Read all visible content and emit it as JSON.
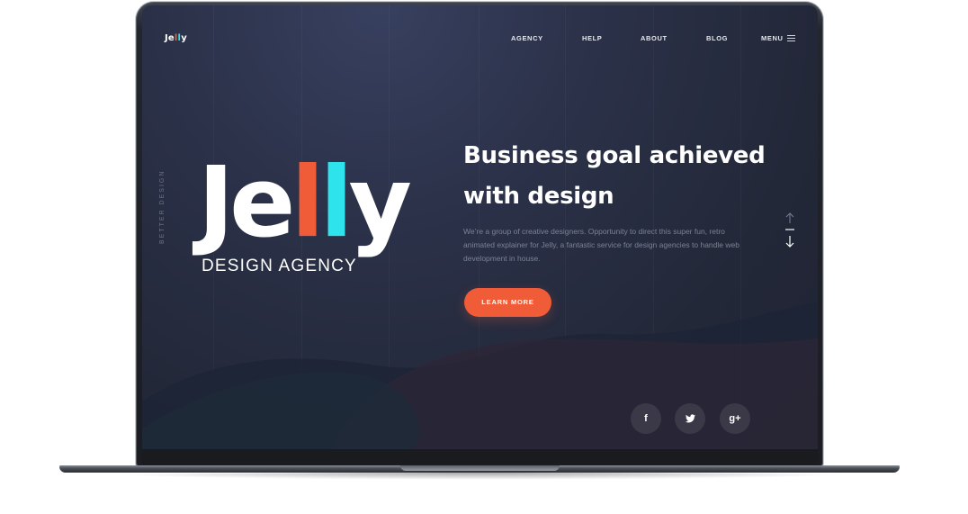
{
  "logo": {
    "text_prefix": "Je",
    "l1": "l",
    "l2": "l",
    "text_suffix": "y"
  },
  "nav": {
    "items": [
      "AGENCY",
      "HELP",
      "ABOUT",
      "BLOG"
    ],
    "menu_label": "MENU"
  },
  "side_tagline": "BETTER DESIGN",
  "brand": {
    "big_prefix": "Je",
    "big_l1": "l",
    "big_l2": "l",
    "big_suffix": "y",
    "subtitle": "DESIGN AGENCY"
  },
  "hero": {
    "headline_line1": "Business goal achieved",
    "headline_line2": "with design",
    "description": "We’re a group of creative  designers. Opportunity to direct this super fun, retro animated explainer for Jelly, a fantastic service for design agencies to handle web development in house.",
    "cta_label": "LEARN MORE"
  },
  "social": {
    "facebook": "f",
    "twitter": "twitter-bird",
    "google_plus": "g+"
  },
  "colors": {
    "accent_orange": "#f05b38",
    "accent_cyan": "#2fe3ec",
    "background": "#252a3b"
  }
}
